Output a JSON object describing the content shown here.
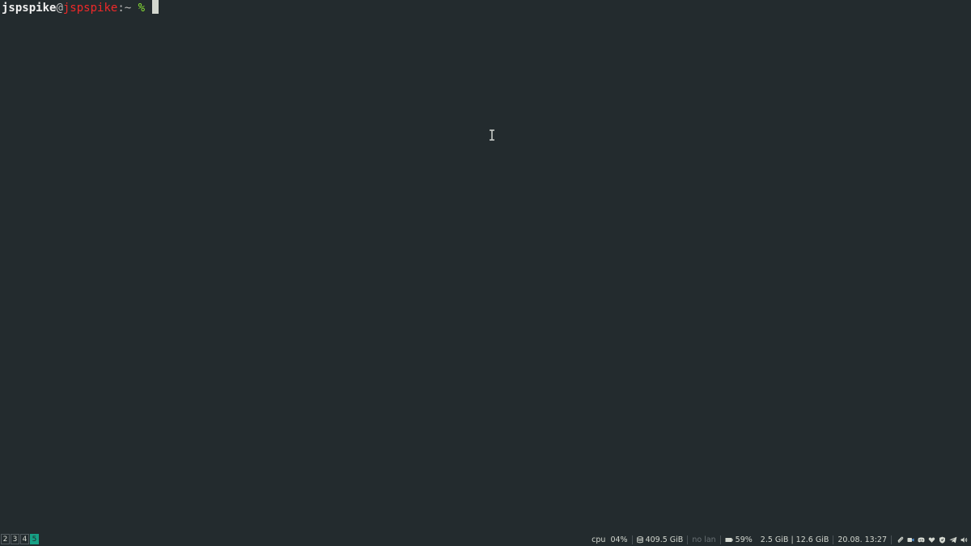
{
  "terminal": {
    "prompt": {
      "user": "jspspike",
      "at": "@",
      "host": "jspspike",
      "separator": ":~ ",
      "symbol": "%"
    }
  },
  "statusbar": {
    "workspaces": [
      {
        "label": "2",
        "active": false
      },
      {
        "label": "3",
        "active": false
      },
      {
        "label": "4",
        "active": false
      },
      {
        "label": "5",
        "active": true
      }
    ],
    "cpu_label": "cpu",
    "cpu_value": "04%",
    "disk_value": "409.5 GiB",
    "lan_value": "no lan",
    "battery_value": "59%",
    "memory_value": "2.5 GiB | 12.6 GiB",
    "datetime_value": "20.08. 13:27",
    "tray_icons": [
      "paperclip-icon",
      "camera-icon",
      "discord-icon",
      "heart-icon",
      "shield-icon",
      "telegram-icon",
      "volume-icon"
    ],
    "accent_color": "#16a085"
  }
}
